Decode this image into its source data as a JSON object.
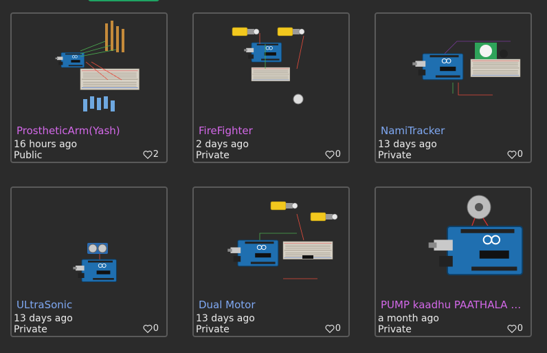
{
  "colors": {
    "title_purple": "#d368e8",
    "title_blue": "#7fa8f2",
    "card_border": "#5a5a5a",
    "background": "#2b2b2b"
  },
  "projects": [
    {
      "title": "ProstheticArm(Yash)",
      "time": "16 hours ago",
      "visibility": "Public",
      "likes": "2",
      "title_color": "#d368e8"
    },
    {
      "title": "FireFighter",
      "time": "2 days ago",
      "visibility": "Private",
      "likes": "0",
      "title_color": "#d368e8"
    },
    {
      "title": "NamiTracker",
      "time": "13 days ago",
      "visibility": "Private",
      "likes": "0",
      "title_color": "#7fa8f2"
    },
    {
      "title": "ULtraSonic",
      "time": "13 days ago",
      "visibility": "Private",
      "likes": "0",
      "title_color": "#7fa8f2"
    },
    {
      "title": "Dual Motor",
      "time": "13 days ago",
      "visibility": "Private",
      "likes": "0",
      "title_color": "#7fa8f2"
    },
    {
      "title": "PUMP kaadhu PAATHALA G...",
      "time": "a month ago",
      "visibility": "Private",
      "likes": "0",
      "title_color": "#d368e8"
    }
  ]
}
